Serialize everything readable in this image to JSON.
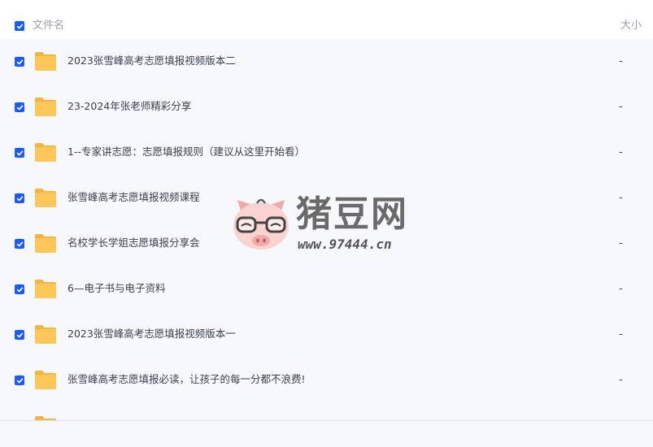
{
  "header": {
    "name_label": "文件名",
    "size_label": "大小"
  },
  "files": [
    {
      "name": "2023张雪峰高考志愿填报视频版本二",
      "size": "-"
    },
    {
      "name": "23-2024年张老师精彩分享",
      "size": "-"
    },
    {
      "name": "1--专家讲志愿：志愿填报规则（建议从这里开始看）",
      "size": "-"
    },
    {
      "name": "张雪峰高考志愿填报视频课程",
      "size": "-"
    },
    {
      "name": "名校学长学姐志愿填报分享会",
      "size": "-"
    },
    {
      "name": "6—电子书与电子资料",
      "size": "-"
    },
    {
      "name": "2023张雪峰高考志愿填报视频版本一",
      "size": "-"
    },
    {
      "name": "张雪峰高考志愿填报必读，让孩子的每一分都不浪费!",
      "size": "-"
    }
  ],
  "watermark": {
    "title": "猪豆网",
    "url": "www.97444.cn"
  },
  "colors": {
    "accent": "#1a5cf5",
    "folder": "#ffc75a",
    "folder_back": "#f5b443",
    "row_background": "#f7f8fc"
  },
  "icons": {
    "checkbox": "checkbox-checked-icon",
    "folder": "folder-icon",
    "watermark": "pig-face-logo"
  }
}
